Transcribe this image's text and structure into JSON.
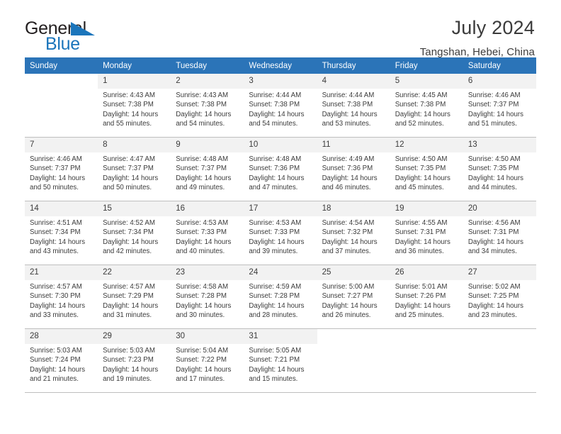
{
  "brand": {
    "name_part1": "General",
    "name_part2": "Blue",
    "accent_color": "#1b75bb"
  },
  "header": {
    "title": "July 2024",
    "subtitle": "Tangshan, Hebei, China",
    "header_bg_color": "#2b74b8",
    "daynum_bg_color": "#f2f2f2"
  },
  "weekdays": [
    "Sunday",
    "Monday",
    "Tuesday",
    "Wednesday",
    "Thursday",
    "Friday",
    "Saturday"
  ],
  "weeks": [
    [
      {
        "day": "",
        "sunrise": "",
        "sunset": "",
        "daylight_line1": "",
        "daylight_line2": ""
      },
      {
        "day": "1",
        "sunrise": "Sunrise: 4:43 AM",
        "sunset": "Sunset: 7:38 PM",
        "daylight_line1": "Daylight: 14 hours",
        "daylight_line2": "and 55 minutes."
      },
      {
        "day": "2",
        "sunrise": "Sunrise: 4:43 AM",
        "sunset": "Sunset: 7:38 PM",
        "daylight_line1": "Daylight: 14 hours",
        "daylight_line2": "and 54 minutes."
      },
      {
        "day": "3",
        "sunrise": "Sunrise: 4:44 AM",
        "sunset": "Sunset: 7:38 PM",
        "daylight_line1": "Daylight: 14 hours",
        "daylight_line2": "and 54 minutes."
      },
      {
        "day": "4",
        "sunrise": "Sunrise: 4:44 AM",
        "sunset": "Sunset: 7:38 PM",
        "daylight_line1": "Daylight: 14 hours",
        "daylight_line2": "and 53 minutes."
      },
      {
        "day": "5",
        "sunrise": "Sunrise: 4:45 AM",
        "sunset": "Sunset: 7:38 PM",
        "daylight_line1": "Daylight: 14 hours",
        "daylight_line2": "and 52 minutes."
      },
      {
        "day": "6",
        "sunrise": "Sunrise: 4:46 AM",
        "sunset": "Sunset: 7:37 PM",
        "daylight_line1": "Daylight: 14 hours",
        "daylight_line2": "and 51 minutes."
      }
    ],
    [
      {
        "day": "7",
        "sunrise": "Sunrise: 4:46 AM",
        "sunset": "Sunset: 7:37 PM",
        "daylight_line1": "Daylight: 14 hours",
        "daylight_line2": "and 50 minutes."
      },
      {
        "day": "8",
        "sunrise": "Sunrise: 4:47 AM",
        "sunset": "Sunset: 7:37 PM",
        "daylight_line1": "Daylight: 14 hours",
        "daylight_line2": "and 50 minutes."
      },
      {
        "day": "9",
        "sunrise": "Sunrise: 4:48 AM",
        "sunset": "Sunset: 7:37 PM",
        "daylight_line1": "Daylight: 14 hours",
        "daylight_line2": "and 49 minutes."
      },
      {
        "day": "10",
        "sunrise": "Sunrise: 4:48 AM",
        "sunset": "Sunset: 7:36 PM",
        "daylight_line1": "Daylight: 14 hours",
        "daylight_line2": "and 47 minutes."
      },
      {
        "day": "11",
        "sunrise": "Sunrise: 4:49 AM",
        "sunset": "Sunset: 7:36 PM",
        "daylight_line1": "Daylight: 14 hours",
        "daylight_line2": "and 46 minutes."
      },
      {
        "day": "12",
        "sunrise": "Sunrise: 4:50 AM",
        "sunset": "Sunset: 7:35 PM",
        "daylight_line1": "Daylight: 14 hours",
        "daylight_line2": "and 45 minutes."
      },
      {
        "day": "13",
        "sunrise": "Sunrise: 4:50 AM",
        "sunset": "Sunset: 7:35 PM",
        "daylight_line1": "Daylight: 14 hours",
        "daylight_line2": "and 44 minutes."
      }
    ],
    [
      {
        "day": "14",
        "sunrise": "Sunrise: 4:51 AM",
        "sunset": "Sunset: 7:34 PM",
        "daylight_line1": "Daylight: 14 hours",
        "daylight_line2": "and 43 minutes."
      },
      {
        "day": "15",
        "sunrise": "Sunrise: 4:52 AM",
        "sunset": "Sunset: 7:34 PM",
        "daylight_line1": "Daylight: 14 hours",
        "daylight_line2": "and 42 minutes."
      },
      {
        "day": "16",
        "sunrise": "Sunrise: 4:53 AM",
        "sunset": "Sunset: 7:33 PM",
        "daylight_line1": "Daylight: 14 hours",
        "daylight_line2": "and 40 minutes."
      },
      {
        "day": "17",
        "sunrise": "Sunrise: 4:53 AM",
        "sunset": "Sunset: 7:33 PM",
        "daylight_line1": "Daylight: 14 hours",
        "daylight_line2": "and 39 minutes."
      },
      {
        "day": "18",
        "sunrise": "Sunrise: 4:54 AM",
        "sunset": "Sunset: 7:32 PM",
        "daylight_line1": "Daylight: 14 hours",
        "daylight_line2": "and 37 minutes."
      },
      {
        "day": "19",
        "sunrise": "Sunrise: 4:55 AM",
        "sunset": "Sunset: 7:31 PM",
        "daylight_line1": "Daylight: 14 hours",
        "daylight_line2": "and 36 minutes."
      },
      {
        "day": "20",
        "sunrise": "Sunrise: 4:56 AM",
        "sunset": "Sunset: 7:31 PM",
        "daylight_line1": "Daylight: 14 hours",
        "daylight_line2": "and 34 minutes."
      }
    ],
    [
      {
        "day": "21",
        "sunrise": "Sunrise: 4:57 AM",
        "sunset": "Sunset: 7:30 PM",
        "daylight_line1": "Daylight: 14 hours",
        "daylight_line2": "and 33 minutes."
      },
      {
        "day": "22",
        "sunrise": "Sunrise: 4:57 AM",
        "sunset": "Sunset: 7:29 PM",
        "daylight_line1": "Daylight: 14 hours",
        "daylight_line2": "and 31 minutes."
      },
      {
        "day": "23",
        "sunrise": "Sunrise: 4:58 AM",
        "sunset": "Sunset: 7:28 PM",
        "daylight_line1": "Daylight: 14 hours",
        "daylight_line2": "and 30 minutes."
      },
      {
        "day": "24",
        "sunrise": "Sunrise: 4:59 AM",
        "sunset": "Sunset: 7:28 PM",
        "daylight_line1": "Daylight: 14 hours",
        "daylight_line2": "and 28 minutes."
      },
      {
        "day": "25",
        "sunrise": "Sunrise: 5:00 AM",
        "sunset": "Sunset: 7:27 PM",
        "daylight_line1": "Daylight: 14 hours",
        "daylight_line2": "and 26 minutes."
      },
      {
        "day": "26",
        "sunrise": "Sunrise: 5:01 AM",
        "sunset": "Sunset: 7:26 PM",
        "daylight_line1": "Daylight: 14 hours",
        "daylight_line2": "and 25 minutes."
      },
      {
        "day": "27",
        "sunrise": "Sunrise: 5:02 AM",
        "sunset": "Sunset: 7:25 PM",
        "daylight_line1": "Daylight: 14 hours",
        "daylight_line2": "and 23 minutes."
      }
    ],
    [
      {
        "day": "28",
        "sunrise": "Sunrise: 5:03 AM",
        "sunset": "Sunset: 7:24 PM",
        "daylight_line1": "Daylight: 14 hours",
        "daylight_line2": "and 21 minutes."
      },
      {
        "day": "29",
        "sunrise": "Sunrise: 5:03 AM",
        "sunset": "Sunset: 7:23 PM",
        "daylight_line1": "Daylight: 14 hours",
        "daylight_line2": "and 19 minutes."
      },
      {
        "day": "30",
        "sunrise": "Sunrise: 5:04 AM",
        "sunset": "Sunset: 7:22 PM",
        "daylight_line1": "Daylight: 14 hours",
        "daylight_line2": "and 17 minutes."
      },
      {
        "day": "31",
        "sunrise": "Sunrise: 5:05 AM",
        "sunset": "Sunset: 7:21 PM",
        "daylight_line1": "Daylight: 14 hours",
        "daylight_line2": "and 15 minutes."
      },
      {
        "day": "",
        "sunrise": "",
        "sunset": "",
        "daylight_line1": "",
        "daylight_line2": ""
      },
      {
        "day": "",
        "sunrise": "",
        "sunset": "",
        "daylight_line1": "",
        "daylight_line2": ""
      },
      {
        "day": "",
        "sunrise": "",
        "sunset": "",
        "daylight_line1": "",
        "daylight_line2": ""
      }
    ]
  ]
}
